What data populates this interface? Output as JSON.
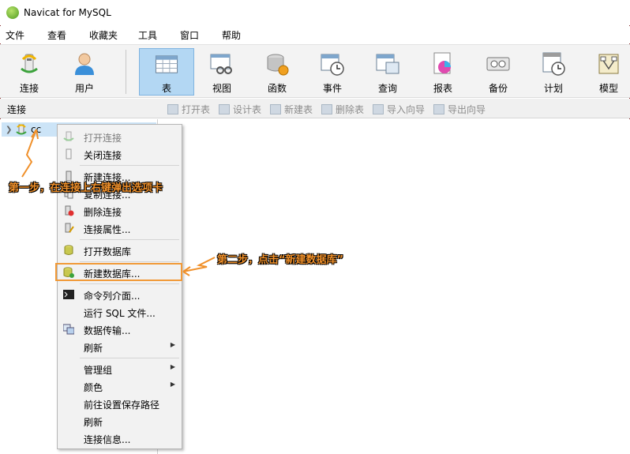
{
  "window": {
    "title": "Navicat for MySQL"
  },
  "menu": [
    "文件",
    "查看",
    "收藏夹",
    "工具",
    "窗口",
    "帮助"
  ],
  "toolbar": {
    "items": [
      {
        "label": "连接",
        "icon": "plug-icon"
      },
      {
        "label": "用户",
        "icon": "user-icon"
      },
      {
        "label": "表",
        "icon": "table-icon",
        "active": true
      },
      {
        "label": "视图",
        "icon": "view-icon"
      },
      {
        "label": "函数",
        "icon": "function-icon"
      },
      {
        "label": "事件",
        "icon": "event-icon"
      },
      {
        "label": "查询",
        "icon": "query-icon"
      },
      {
        "label": "报表",
        "icon": "report-icon"
      },
      {
        "label": "备份",
        "icon": "backup-icon"
      },
      {
        "label": "计划",
        "icon": "schedule-icon"
      },
      {
        "label": "模型",
        "icon": "model-icon"
      }
    ]
  },
  "subbar": {
    "label": "连接",
    "buttons": [
      "打开表",
      "设计表",
      "新建表",
      "删除表",
      "导入向导",
      "导出向导"
    ]
  },
  "tree": {
    "connection": "cc"
  },
  "context_menu": {
    "items": [
      "打开连接",
      "关闭连接",
      "新建连接...",
      "复制连接...",
      "删除连接",
      "连接属性...",
      "打开数据库",
      "新建数据库...",
      "命令列介面...",
      "运行 SQL 文件...",
      "数据传输...",
      "刷新",
      "管理组",
      "颜色",
      "前往设置保存路径",
      "刷新",
      "连接信息..."
    ]
  },
  "annotations": {
    "step1": "第一步，在连接上右键弹出选项卡",
    "step2": "第二步，点击“新建数据库”"
  },
  "colors": {
    "annotation": "#f0902a",
    "active_tool": "#b3d7f3",
    "selection": "#cce4f7"
  }
}
